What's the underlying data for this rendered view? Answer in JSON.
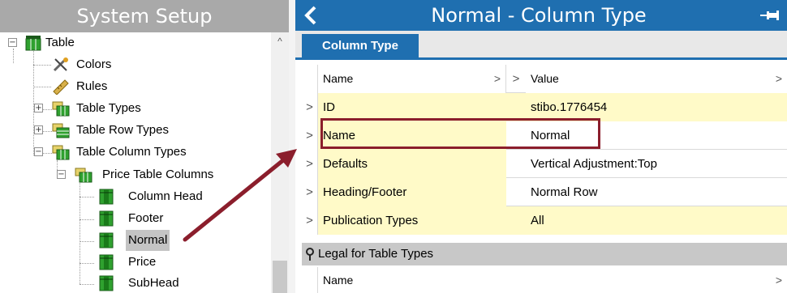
{
  "left_panel": {
    "title": "System Setup",
    "tree": [
      {
        "label": "Table",
        "expander": "−"
      },
      {
        "label": "Colors"
      },
      {
        "label": "Rules"
      },
      {
        "label": "Table Types",
        "expander": "+"
      },
      {
        "label": "Table Row Types",
        "expander": "+"
      },
      {
        "label": "Table Column Types",
        "expander": "−"
      },
      {
        "label": "Price Table Columns",
        "expander": "−"
      },
      {
        "label": "Column Head"
      },
      {
        "label": "Footer"
      },
      {
        "label": "Normal",
        "selected": true
      },
      {
        "label": "Price"
      },
      {
        "label": "SubHead"
      }
    ]
  },
  "right_panel": {
    "title": "Normal - Column Type",
    "tab": "Column Type",
    "grid": {
      "header": {
        "name": "Name",
        "value": "Value"
      },
      "rows": [
        {
          "name": "ID",
          "value": "stibo.1776454"
        },
        {
          "name": "Name",
          "value": "Normal"
        },
        {
          "name": "Defaults",
          "value": "Vertical Adjustment:Top"
        },
        {
          "name": "Heading/Footer",
          "value": "Normal Row"
        },
        {
          "name": "Publication Types",
          "value": "All"
        }
      ]
    },
    "legal": {
      "title": "Legal for Table Types",
      "column": "Name"
    }
  },
  "glyphs": {
    "row_arrow": ">",
    "scroll_up": "^"
  },
  "colors": {
    "header_blue": "#1f6fb0",
    "annotation_red": "#8b1e2c",
    "row_yellow": "#fffac8"
  }
}
